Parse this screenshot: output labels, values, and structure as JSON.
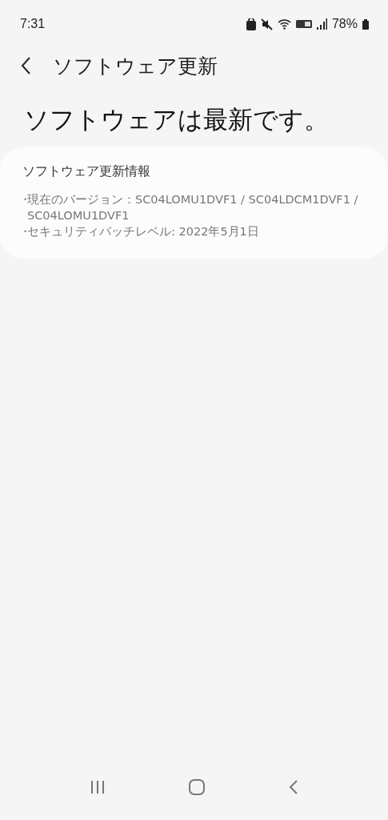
{
  "status_bar": {
    "time": "7:31",
    "battery": "78%"
  },
  "header": {
    "title": "ソフトウェア更新"
  },
  "headline": "ソフトウェアは最新です。",
  "info_card": {
    "title": "ソフトウェア更新情報",
    "items": [
      {
        "bullet": "・",
        "text": "現在のバージョン：SC04LOMU1DVF1 / SC04LDCM1DVF1 / SC04LOMU1DVF1"
      },
      {
        "bullet": "・",
        "text": "セキュリティパッチレベル: 2022年5月1日"
      }
    ]
  }
}
